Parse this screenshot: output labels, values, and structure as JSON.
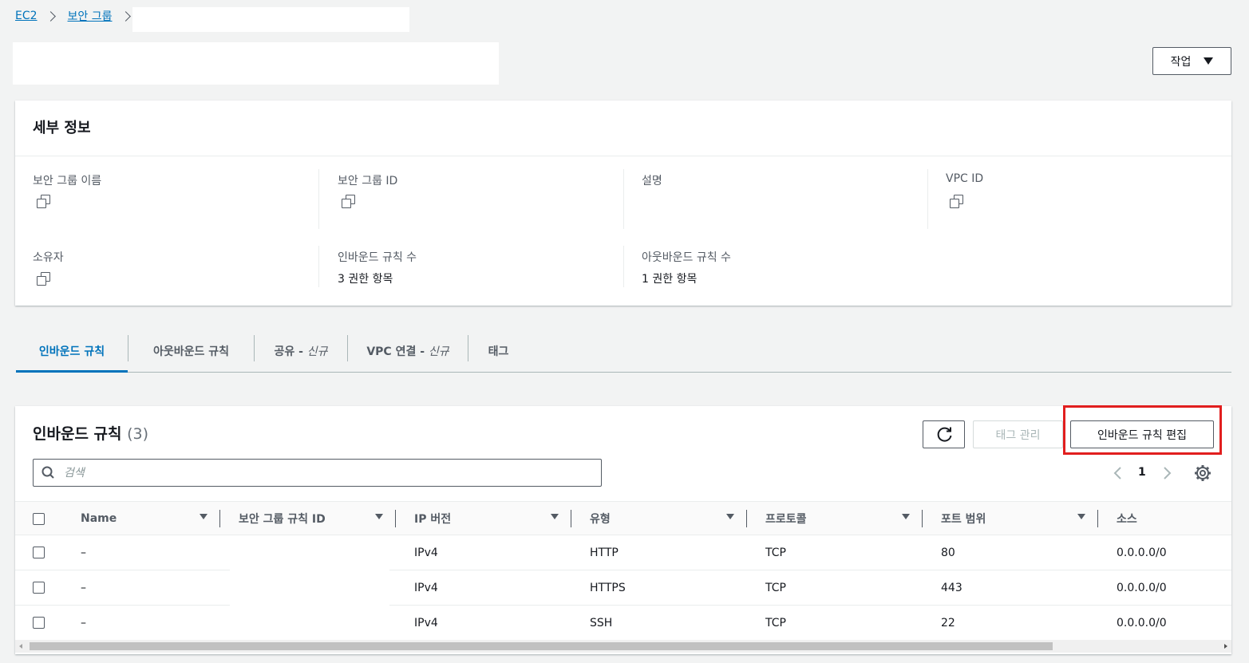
{
  "breadcrumb": {
    "root": "EC2",
    "section": "보안 그룹"
  },
  "header": {
    "actions_label": "작업"
  },
  "details": {
    "title": "세부 정보",
    "fields": {
      "group_name_label": "보안 그룹 이름",
      "group_id_label": "보안 그룹 ID",
      "description_label": "설명",
      "vpc_id_label": "VPC ID",
      "owner_label": "소유자",
      "inbound_count_label": "인바운드 규칙 수",
      "inbound_count_value": "3 권한 항목",
      "outbound_count_label": "아웃바운드 규칙 수",
      "outbound_count_value": "1 권한 항목"
    }
  },
  "tabs": [
    {
      "label": "인바운드 규칙"
    },
    {
      "label": "아웃바운드 규칙"
    },
    {
      "label": "공유 - ",
      "new_label": "신규"
    },
    {
      "label": "VPC 연결 - ",
      "new_label": "신규"
    },
    {
      "label": "태그"
    }
  ],
  "inbound": {
    "title": "인바운드 규칙",
    "count": "(3)",
    "manage_tags_label": "태그 관리",
    "edit_label": "인바운드 규칙 편집",
    "search_placeholder": "검색",
    "page_number": "1",
    "columns": [
      "Name",
      "보안 그룹 규칙 ID",
      "IP 버전",
      "유형",
      "프로토콜",
      "포트 범위",
      "소스"
    ],
    "rows": [
      {
        "name": "–",
        "ip_version": "IPv4",
        "type": "HTTP",
        "protocol": "TCP",
        "port": "80",
        "source": "0.0.0.0/0"
      },
      {
        "name": "–",
        "ip_version": "IPv4",
        "type": "HTTPS",
        "protocol": "TCP",
        "port": "443",
        "source": "0.0.0.0/0"
      },
      {
        "name": "–",
        "ip_version": "IPv4",
        "type": "SSH",
        "protocol": "TCP",
        "port": "22",
        "source": "0.0.0.0/0"
      }
    ]
  },
  "colors": {
    "link": "#0073bb",
    "highlight": "#e11e1e",
    "text": "#16191f",
    "muted": "#545b64"
  }
}
